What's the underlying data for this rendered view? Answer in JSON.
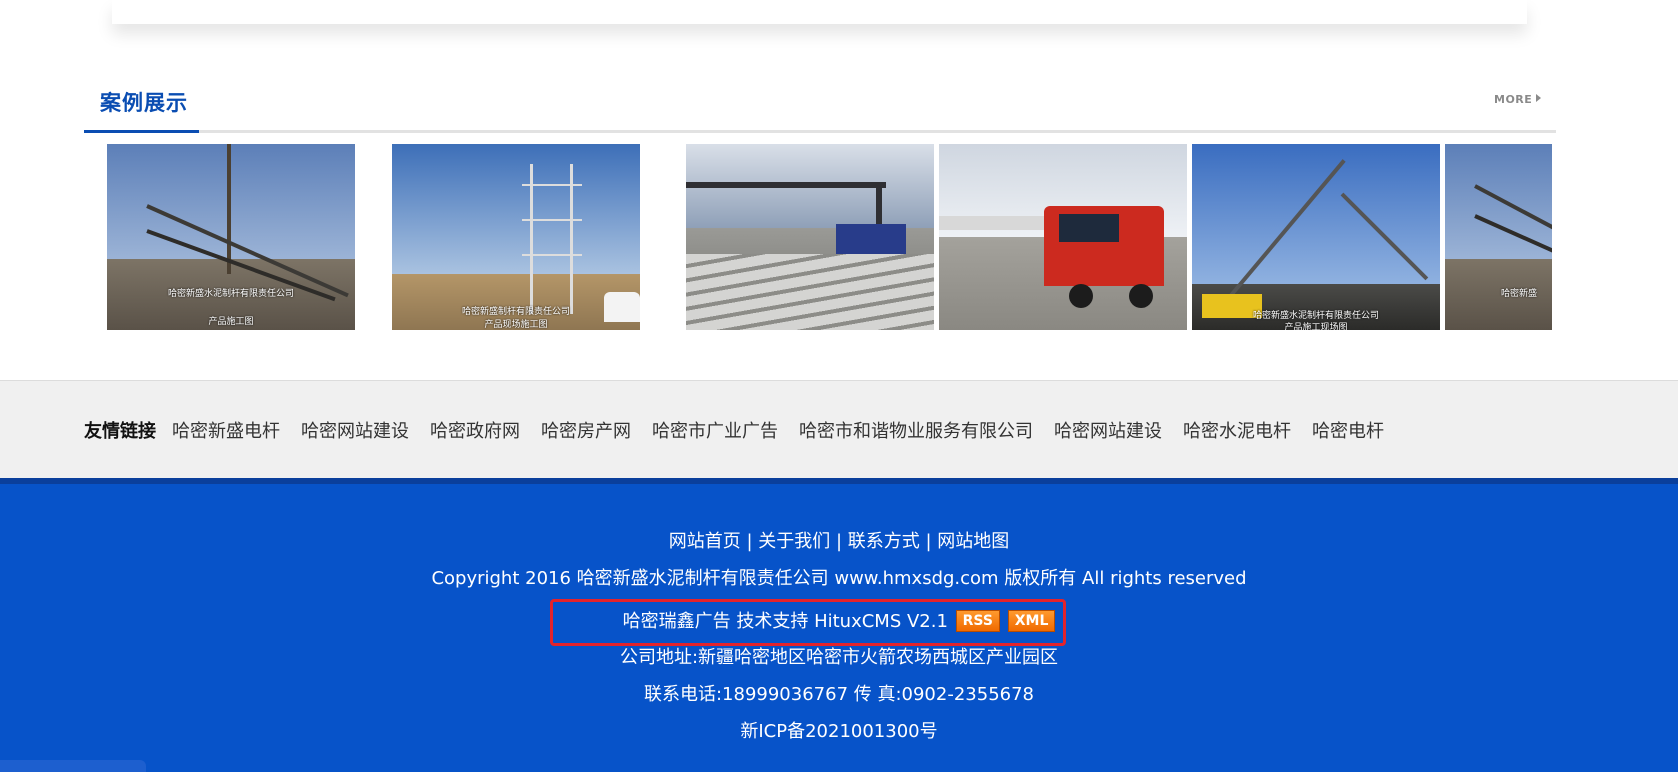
{
  "case_section": {
    "title": "案例展示",
    "more_label": "MORE",
    "photos": [
      {
        "caption_line1": "哈密新盛水泥制杆有限责任公司",
        "caption_line2": "产品施工图"
      },
      {
        "caption_line1": "哈密新盛制杆有限责任公司",
        "caption_line2": "产品现场施工图"
      },
      {
        "caption_line1": "",
        "caption_line2": ""
      },
      {
        "caption_line1": "",
        "caption_line2": ""
      },
      {
        "caption_line1": "哈密新盛水泥制杆有限责任公司",
        "caption_line2": "产品施工现场图"
      },
      {
        "caption_line1": "哈密新盛",
        "caption_line2": ""
      }
    ]
  },
  "friend_links": {
    "label": "友情链接",
    "items": [
      "哈密新盛电杆",
      "哈密网站建设",
      "哈密政府网",
      "哈密房产网",
      "哈密市广业广告",
      "哈密市和谐物业服务有限公司",
      "哈密网站建设",
      "哈密水泥电杆",
      "哈密电杆"
    ]
  },
  "footer": {
    "nav": [
      "网站首页",
      "关于我们",
      "联系方式",
      "网站地图"
    ],
    "nav_separator": " | ",
    "copyright": "Copyright 2016 哈密新盛水泥制杆有限责任公司 www.hmxsdg.com 版权所有 All rights reserved",
    "support_text": "哈密瑞鑫广告 技术支持 HituxCMS V2.1",
    "rss_label": "RSS",
    "xml_label": "XML",
    "address": "公司地址:新疆哈密地区哈密市火箭农场西城区产业园区",
    "contact": "联系电话:18999036767 传 真:0902-2355678",
    "icp": "新ICP备2021001300号"
  },
  "colors": {
    "accent": "#0a4db2",
    "footer_bg": "#0753c9",
    "highlight": "#e4232b",
    "badge": "#f07a10"
  }
}
